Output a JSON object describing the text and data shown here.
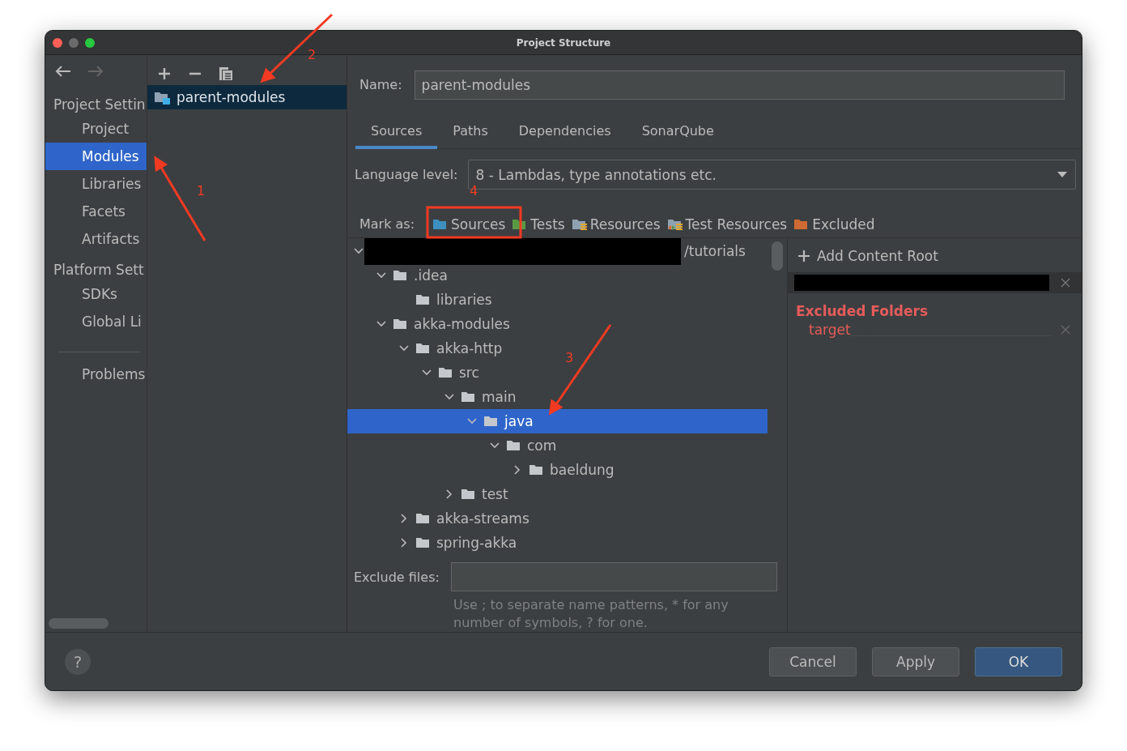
{
  "window": {
    "title": "Project Structure"
  },
  "sidebar": {
    "sections": [
      {
        "title": "Project Settin",
        "items": [
          {
            "label": "Project",
            "selected": false
          },
          {
            "label": "Modules",
            "selected": true
          },
          {
            "label": "Libraries",
            "selected": false
          },
          {
            "label": "Facets",
            "selected": false
          },
          {
            "label": "Artifacts",
            "selected": false
          }
        ]
      },
      {
        "title": "Platform Sett",
        "items": [
          {
            "label": "SDKs",
            "selected": false
          },
          {
            "label": "Global Li",
            "selected": false
          }
        ]
      },
      {
        "items": [
          {
            "label": "Problems",
            "selected": false
          }
        ]
      }
    ]
  },
  "modules": [
    {
      "label": "parent-modules",
      "selected": true
    }
  ],
  "name_field": {
    "label": "Name:",
    "value": "parent-modules"
  },
  "tabs": [
    {
      "label": "Sources",
      "selected": true
    },
    {
      "label": "Paths",
      "selected": false
    },
    {
      "label": "Dependencies",
      "selected": false
    },
    {
      "label": "SonarQube",
      "selected": false
    }
  ],
  "language_level": {
    "label": "Language level:",
    "value": "8 - Lambdas, type annotations etc."
  },
  "mark_as": {
    "label": "Mark as:",
    "options": [
      {
        "kind": "sources",
        "label": "Sources"
      },
      {
        "kind": "tests",
        "label": "Tests"
      },
      {
        "kind": "resources",
        "label": "Resources"
      },
      {
        "kind": "test_resources",
        "label": "Test Resources"
      },
      {
        "kind": "excluded",
        "label": "Excluded"
      }
    ]
  },
  "tree": [
    {
      "label": "/tutorials",
      "redacted": true,
      "expanded": true,
      "selected": false,
      "children": [
        {
          "label": ".idea",
          "expanded": true,
          "selected": false,
          "children": [
            {
              "label": "libraries",
              "selected": false
            }
          ]
        },
        {
          "label": "akka-modules",
          "expanded": true,
          "selected": false,
          "children": [
            {
              "label": "akka-http",
              "expanded": true,
              "selected": false,
              "children": [
                {
                  "label": "src",
                  "expanded": true,
                  "selected": false,
                  "children": [
                    {
                      "label": "main",
                      "expanded": true,
                      "selected": false,
                      "children": [
                        {
                          "label": "java",
                          "expanded": true,
                          "selected": true,
                          "children": [
                            {
                              "label": "com",
                              "expanded": true,
                              "selected": false,
                              "children": [
                                {
                                  "label": "baeldung",
                                  "expanded": false,
                                  "selected": false
                                }
                              ]
                            }
                          ]
                        }
                      ]
                    },
                    {
                      "label": "test",
                      "expanded": false,
                      "selected": false
                    }
                  ]
                }
              ]
            },
            {
              "label": "akka-streams",
              "expanded": false,
              "selected": false
            },
            {
              "label": "spring-akka",
              "expanded": false,
              "selected": false
            }
          ]
        }
      ]
    }
  ],
  "exclude_files": {
    "label": "Exclude files:",
    "hint": "Use ; to separate name patterns, * for any number of symbols, ? for one."
  },
  "content_root": {
    "add_label": "Add Content Root",
    "excluded_title": "Excluded Folders",
    "excluded": [
      "target"
    ]
  },
  "help": {
    "label": "?"
  },
  "buttons": [
    {
      "label": "Cancel",
      "default": false
    },
    {
      "label": "Apply",
      "default": false
    },
    {
      "label": "OK",
      "default": true
    }
  ],
  "annotations": [
    {
      "label": "1"
    },
    {
      "label": "2"
    },
    {
      "label": "3"
    },
    {
      "label": "4"
    }
  ]
}
